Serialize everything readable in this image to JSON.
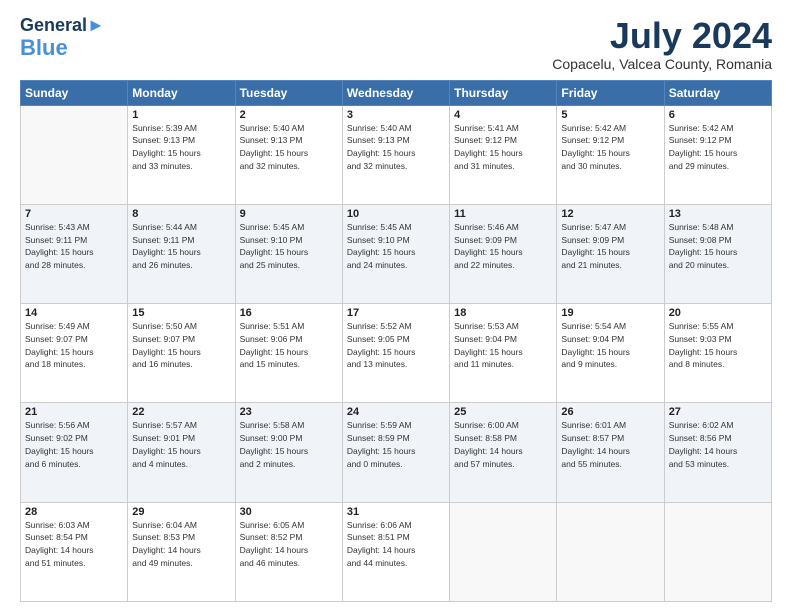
{
  "header": {
    "logo_line1": "General",
    "logo_line2": "Blue",
    "title": "July 2024",
    "subtitle": "Copacelu, Valcea County, Romania"
  },
  "weekdays": [
    "Sunday",
    "Monday",
    "Tuesday",
    "Wednesday",
    "Thursday",
    "Friday",
    "Saturday"
  ],
  "weeks": [
    [
      {
        "day": "",
        "info": ""
      },
      {
        "day": "1",
        "info": "Sunrise: 5:39 AM\nSunset: 9:13 PM\nDaylight: 15 hours\nand 33 minutes."
      },
      {
        "day": "2",
        "info": "Sunrise: 5:40 AM\nSunset: 9:13 PM\nDaylight: 15 hours\nand 32 minutes."
      },
      {
        "day": "3",
        "info": "Sunrise: 5:40 AM\nSunset: 9:13 PM\nDaylight: 15 hours\nand 32 minutes."
      },
      {
        "day": "4",
        "info": "Sunrise: 5:41 AM\nSunset: 9:12 PM\nDaylight: 15 hours\nand 31 minutes."
      },
      {
        "day": "5",
        "info": "Sunrise: 5:42 AM\nSunset: 9:12 PM\nDaylight: 15 hours\nand 30 minutes."
      },
      {
        "day": "6",
        "info": "Sunrise: 5:42 AM\nSunset: 9:12 PM\nDaylight: 15 hours\nand 29 minutes."
      }
    ],
    [
      {
        "day": "7",
        "info": "Sunrise: 5:43 AM\nSunset: 9:11 PM\nDaylight: 15 hours\nand 28 minutes."
      },
      {
        "day": "8",
        "info": "Sunrise: 5:44 AM\nSunset: 9:11 PM\nDaylight: 15 hours\nand 26 minutes."
      },
      {
        "day": "9",
        "info": "Sunrise: 5:45 AM\nSunset: 9:10 PM\nDaylight: 15 hours\nand 25 minutes."
      },
      {
        "day": "10",
        "info": "Sunrise: 5:45 AM\nSunset: 9:10 PM\nDaylight: 15 hours\nand 24 minutes."
      },
      {
        "day": "11",
        "info": "Sunrise: 5:46 AM\nSunset: 9:09 PM\nDaylight: 15 hours\nand 22 minutes."
      },
      {
        "day": "12",
        "info": "Sunrise: 5:47 AM\nSunset: 9:09 PM\nDaylight: 15 hours\nand 21 minutes."
      },
      {
        "day": "13",
        "info": "Sunrise: 5:48 AM\nSunset: 9:08 PM\nDaylight: 15 hours\nand 20 minutes."
      }
    ],
    [
      {
        "day": "14",
        "info": "Sunrise: 5:49 AM\nSunset: 9:07 PM\nDaylight: 15 hours\nand 18 minutes."
      },
      {
        "day": "15",
        "info": "Sunrise: 5:50 AM\nSunset: 9:07 PM\nDaylight: 15 hours\nand 16 minutes."
      },
      {
        "day": "16",
        "info": "Sunrise: 5:51 AM\nSunset: 9:06 PM\nDaylight: 15 hours\nand 15 minutes."
      },
      {
        "day": "17",
        "info": "Sunrise: 5:52 AM\nSunset: 9:05 PM\nDaylight: 15 hours\nand 13 minutes."
      },
      {
        "day": "18",
        "info": "Sunrise: 5:53 AM\nSunset: 9:04 PM\nDaylight: 15 hours\nand 11 minutes."
      },
      {
        "day": "19",
        "info": "Sunrise: 5:54 AM\nSunset: 9:04 PM\nDaylight: 15 hours\nand 9 minutes."
      },
      {
        "day": "20",
        "info": "Sunrise: 5:55 AM\nSunset: 9:03 PM\nDaylight: 15 hours\nand 8 minutes."
      }
    ],
    [
      {
        "day": "21",
        "info": "Sunrise: 5:56 AM\nSunset: 9:02 PM\nDaylight: 15 hours\nand 6 minutes."
      },
      {
        "day": "22",
        "info": "Sunrise: 5:57 AM\nSunset: 9:01 PM\nDaylight: 15 hours\nand 4 minutes."
      },
      {
        "day": "23",
        "info": "Sunrise: 5:58 AM\nSunset: 9:00 PM\nDaylight: 15 hours\nand 2 minutes."
      },
      {
        "day": "24",
        "info": "Sunrise: 5:59 AM\nSunset: 8:59 PM\nDaylight: 15 hours\nand 0 minutes."
      },
      {
        "day": "25",
        "info": "Sunrise: 6:00 AM\nSunset: 8:58 PM\nDaylight: 14 hours\nand 57 minutes."
      },
      {
        "day": "26",
        "info": "Sunrise: 6:01 AM\nSunset: 8:57 PM\nDaylight: 14 hours\nand 55 minutes."
      },
      {
        "day": "27",
        "info": "Sunrise: 6:02 AM\nSunset: 8:56 PM\nDaylight: 14 hours\nand 53 minutes."
      }
    ],
    [
      {
        "day": "28",
        "info": "Sunrise: 6:03 AM\nSunset: 8:54 PM\nDaylight: 14 hours\nand 51 minutes."
      },
      {
        "day": "29",
        "info": "Sunrise: 6:04 AM\nSunset: 8:53 PM\nDaylight: 14 hours\nand 49 minutes."
      },
      {
        "day": "30",
        "info": "Sunrise: 6:05 AM\nSunset: 8:52 PM\nDaylight: 14 hours\nand 46 minutes."
      },
      {
        "day": "31",
        "info": "Sunrise: 6:06 AM\nSunset: 8:51 PM\nDaylight: 14 hours\nand 44 minutes."
      },
      {
        "day": "",
        "info": ""
      },
      {
        "day": "",
        "info": ""
      },
      {
        "day": "",
        "info": ""
      }
    ]
  ]
}
